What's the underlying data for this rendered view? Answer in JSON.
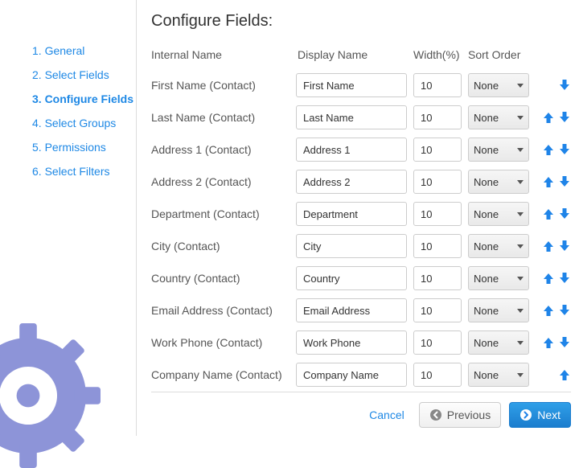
{
  "sidebar": {
    "items": [
      {
        "label": "1. General",
        "active": false
      },
      {
        "label": "2. Select Fields",
        "active": false
      },
      {
        "label": "3. Configure Fields",
        "active": true
      },
      {
        "label": "4. Select Groups",
        "active": false
      },
      {
        "label": "5. Permissions",
        "active": false
      },
      {
        "label": "6. Select Filters",
        "active": false
      }
    ]
  },
  "main": {
    "title": "Configure Fields:",
    "columns": {
      "internal": "Internal Name",
      "display": "Display Name",
      "width": "Width(%)",
      "sort": "Sort Order"
    },
    "fields": [
      {
        "internal": "First Name (Contact)",
        "display": "First Name",
        "width": "10",
        "sort": "None",
        "up": false,
        "down": true
      },
      {
        "internal": "Last Name (Contact)",
        "display": "Last Name",
        "width": "10",
        "sort": "None",
        "up": true,
        "down": true
      },
      {
        "internal": "Address 1 (Contact)",
        "display": "Address 1",
        "width": "10",
        "sort": "None",
        "up": true,
        "down": true
      },
      {
        "internal": "Address 2 (Contact)",
        "display": "Address 2",
        "width": "10",
        "sort": "None",
        "up": true,
        "down": true
      },
      {
        "internal": "Department (Contact)",
        "display": "Department",
        "width": "10",
        "sort": "None",
        "up": true,
        "down": true
      },
      {
        "internal": "City (Contact)",
        "display": "City",
        "width": "10",
        "sort": "None",
        "up": true,
        "down": true
      },
      {
        "internal": "Country (Contact)",
        "display": "Country",
        "width": "10",
        "sort": "None",
        "up": true,
        "down": true
      },
      {
        "internal": "Email Address (Contact)",
        "display": "Email Address",
        "width": "10",
        "sort": "None",
        "up": true,
        "down": true
      },
      {
        "internal": "Work Phone (Contact)",
        "display": "Work Phone",
        "width": "10",
        "sort": "None",
        "up": true,
        "down": true
      },
      {
        "internal": "Company Name (Contact)",
        "display": "Company Name",
        "width": "10",
        "sort": "None",
        "up": true,
        "down": false
      }
    ]
  },
  "footer": {
    "cancel": "Cancel",
    "prev": "Previous",
    "next": "Next"
  },
  "colors": {
    "link": "#1e88e5",
    "primary": "#1f84e8",
    "gear": "#8d94d8"
  }
}
